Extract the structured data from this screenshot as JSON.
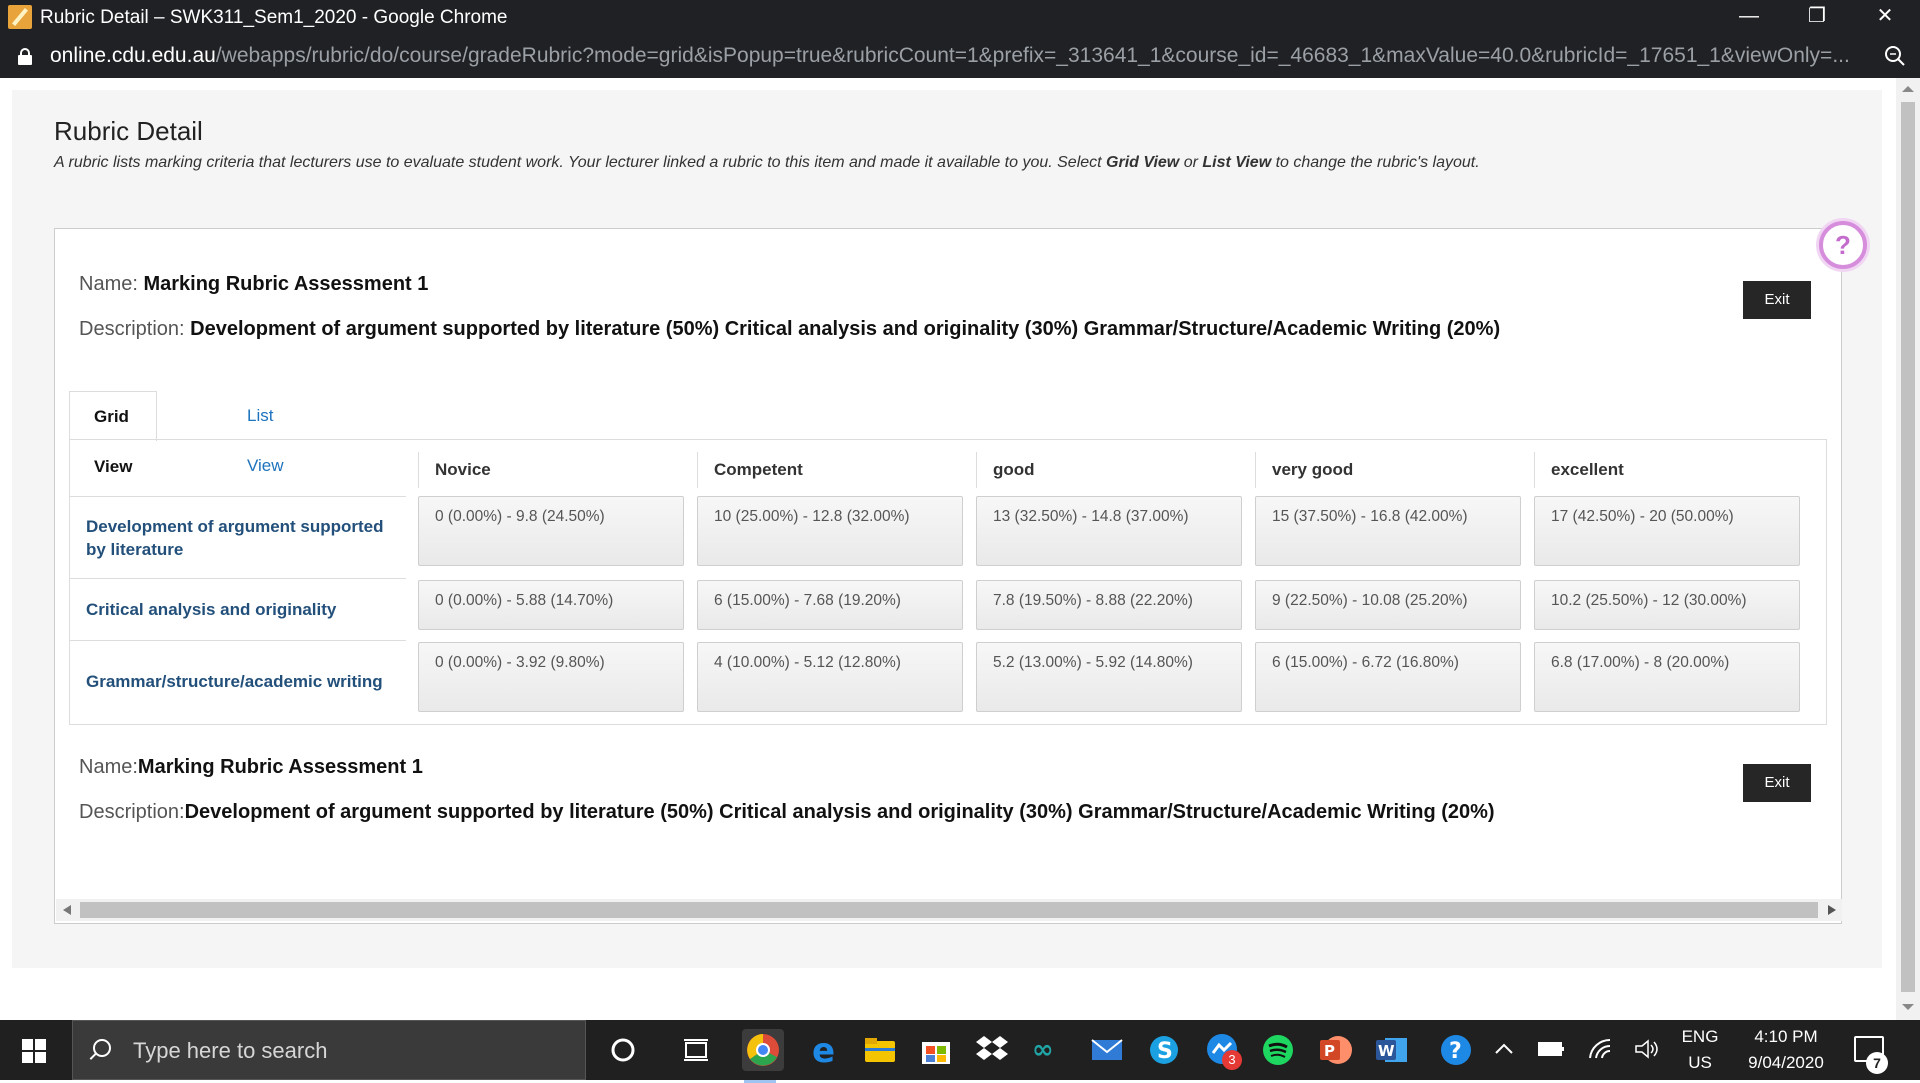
{
  "window": {
    "title": "Rubric Detail – SWK311_Sem1_2020 - Google Chrome",
    "url_host": "online.cdu.edu.au",
    "url_path": "/webapps/rubric/do/course/gradeRubric?mode=grid&isPopup=true&rubricCount=1&prefix=_313641_1&course_id=_46683_1&maxValue=40.0&rubricId=_17651_1&viewOnly=...",
    "minimize": "—",
    "restore": "❐",
    "close": "✕"
  },
  "page": {
    "title": "Rubric Detail",
    "desc_prefix": "A rubric lists marking criteria that lecturers use to evaluate student work. Your lecturer linked a rubric to this item and made it available to you. Select ",
    "desc_grid": "Grid View",
    "desc_or": " or ",
    "desc_list": "List View",
    "desc_suffix": " to change the rubric's layout."
  },
  "rubric": {
    "name_label": "Name:",
    "name": "Marking Rubric Assessment 1",
    "desc_label": "Description:",
    "description": "Development of argument supported by literature  (50%) Critical analysis and originality (30%) Grammar/Structure/Academic Writing (20%)",
    "exit_label": "Exit",
    "help_glyph": "?",
    "tabs": [
      "Grid View",
      "List View"
    ],
    "levels": [
      "Novice",
      "Competent",
      "good",
      "very good",
      "excellent"
    ],
    "criteria": [
      {
        "name": "Development of argument supported by literature",
        "cells": [
          "0 (0.00%) - 9.8 (24.50%)",
          "10 (25.00%) - 12.8 (32.00%)",
          "13 (32.50%) - 14.8 (37.00%)",
          "15 (37.50%) - 16.8 (42.00%)",
          "17 (42.50%) - 20 (50.00%)"
        ]
      },
      {
        "name": "Critical analysis and originality",
        "cells": [
          "0 (0.00%) - 5.88 (14.70%)",
          "6 (15.00%) - 7.68 (19.20%)",
          "7.8 (19.50%) - 8.88 (22.20%)",
          "9 (22.50%) - 10.08 (25.20%)",
          "10.2 (25.50%) - 12 (30.00%)"
        ]
      },
      {
        "name": "Grammar/structure/academic writing",
        "cells": [
          "0 (0.00%) - 3.92 (9.80%)",
          "4 (10.00%) - 5.12 (12.80%)",
          "5.2 (13.00%) - 5.92 (14.80%)",
          "6 (15.00%) - 6.72 (16.80%)",
          "6.8 (17.00%) - 8 (20.00%)"
        ]
      }
    ]
  },
  "taskbar": {
    "search_placeholder": "Type here to search",
    "lang_top": "ENG",
    "lang_bottom": "US",
    "time": "4:10 PM",
    "date": "9/04/2020",
    "messenger_badge": "3",
    "notification_count": "7",
    "colors": {
      "chrome": "#dd4b39",
      "edge": "#1e88e5",
      "explorer": "#f5c400",
      "store": "#4a7fd6",
      "dropbox": "#1a73e8",
      "arduino": "#21a4a6",
      "mail": "#2f7bd6",
      "skype": "#1ba1e2",
      "messenger": "#1e88e5",
      "spotify": "#1ed760",
      "powerpoint": "#d24726",
      "word": "#2b579a",
      "help": "#1e88e5"
    }
  }
}
